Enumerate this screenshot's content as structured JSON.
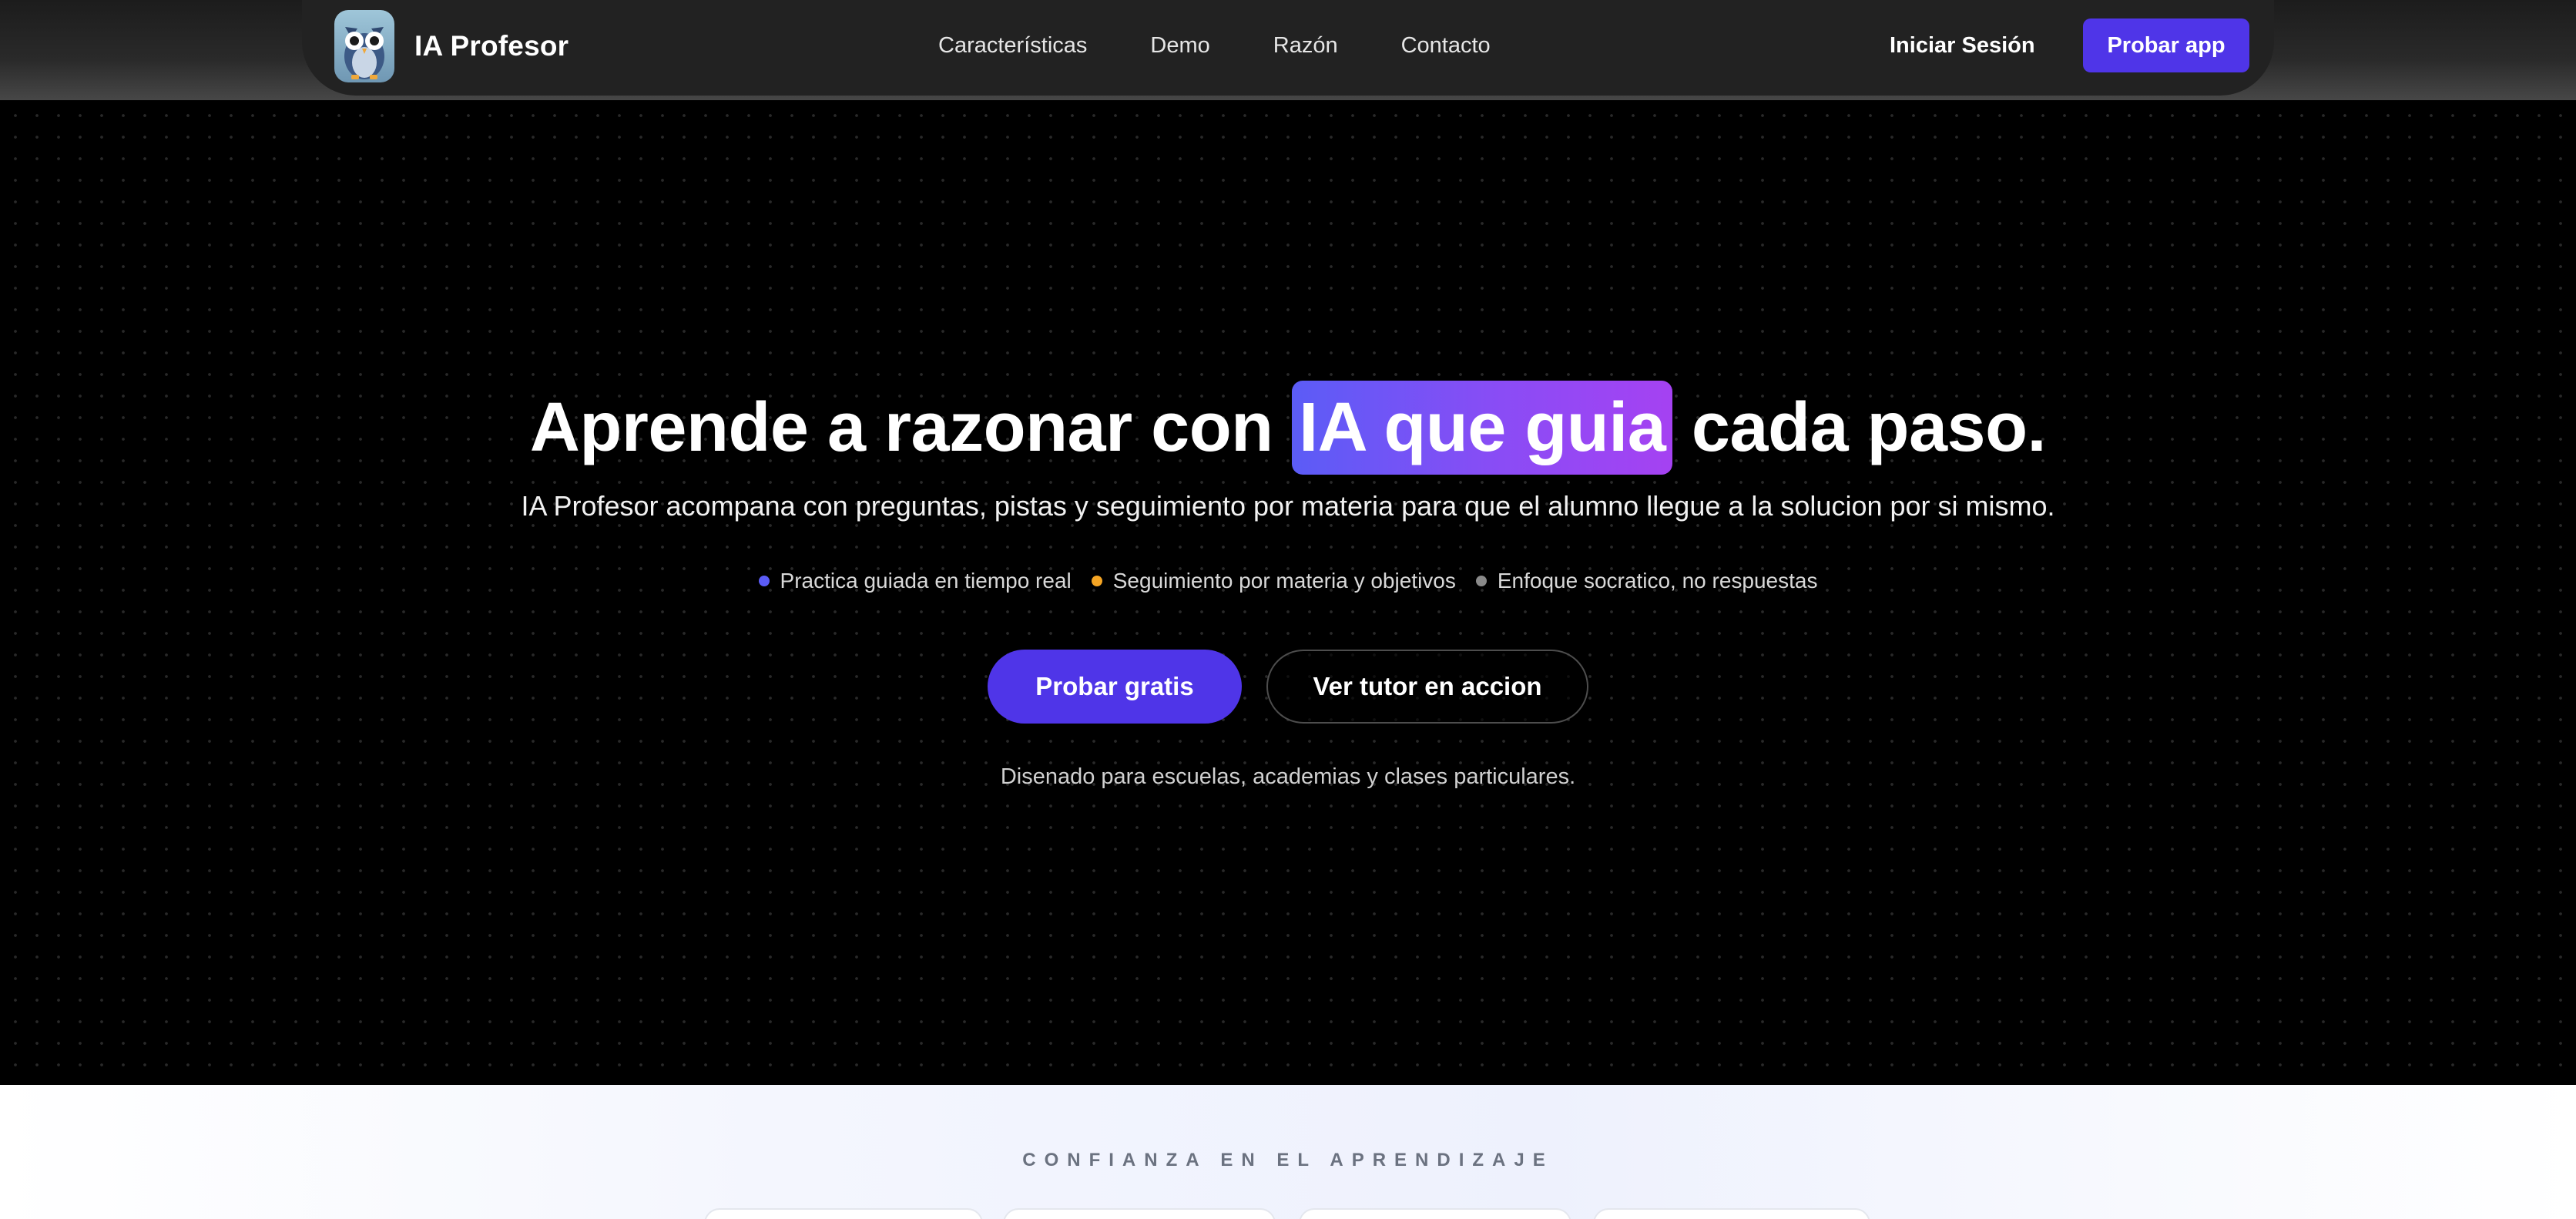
{
  "brand": {
    "name": "IA Profesor",
    "logo_icon": "owl-logo-icon"
  },
  "nav": {
    "links": [
      "Características",
      "Demo",
      "Razón",
      "Contacto"
    ],
    "login_label": "Iniciar Sesión",
    "cta_label": "Probar app"
  },
  "hero": {
    "headline_before": "Aprende a razonar con",
    "headline_highlight": "IA que guia",
    "headline_after": "cada paso.",
    "subtitle": "IA Profesor acompana con preguntas, pistas y seguimiento por materia para que el alumno llegue a la solucion por si mismo.",
    "bullets": [
      {
        "text": "Practica guiada en tiempo real",
        "color": "#5b5cf6"
      },
      {
        "text": "Seguimiento por materia y objetivos",
        "color": "#f5a524"
      },
      {
        "text": "Enfoque socratico, no respuestas",
        "color": "#8a8a8a"
      }
    ],
    "primary_cta": "Probar gratis",
    "secondary_cta": "Ver tutor en accion",
    "note": "Disenado para escuelas, academias y clases particulares."
  },
  "trust": {
    "label": "CONFIANZA EN EL APRENDIZAJE"
  },
  "colors": {
    "accent": "#4f35e8",
    "highlight_start": "#5b5cf6",
    "highlight_end": "#a542f2"
  }
}
